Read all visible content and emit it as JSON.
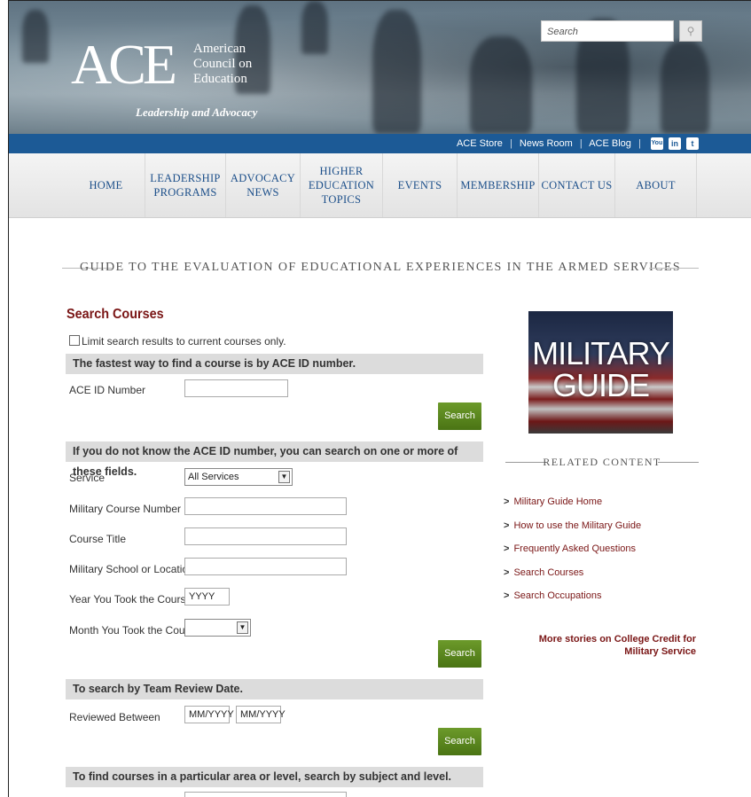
{
  "header": {
    "logo_letters": "ACE",
    "logo_line1": "American",
    "logo_line2": "Council on",
    "logo_line3": "Education",
    "tagline": "Leadership and Advocacy",
    "search_placeholder": "Search",
    "search_icon": "magnifier-icon"
  },
  "utility": {
    "store": "ACE Store",
    "newsroom": "News Room",
    "blog": "ACE Blog",
    "sep": "|",
    "youtube": "You",
    "linkedin": "in",
    "twitter": "t"
  },
  "nav": [
    "HOME",
    "LEADERSHIP PROGRAMS",
    "ADVOCACY NEWS",
    "HIGHER EDUCATION TOPICS",
    "EVENTS",
    "MEMBERSHIP",
    "CONTACT US",
    "ABOUT"
  ],
  "page_title": "GUIDE TO THE EVALUATION OF EDUCATIONAL EXPERIENCES IN THE ARMED SERVICES",
  "search": {
    "heading": "Search Courses",
    "limit_label": "Limit search results to current courses only.",
    "sec1": "The fastest way to find a course is by ACE ID number.",
    "ace_id_label": "ACE ID Number",
    "search_btn": "Search",
    "sec2": "If you do not know the ACE ID number, you can search on one or more of these fields.",
    "service_label": "Service",
    "service_value": "All Services",
    "mcn_label": "Military Course Number",
    "title_label": "Course Title",
    "school_label": "Military School or Location",
    "year_label": "Year You Took the Course",
    "year_value": "YYYY",
    "month_label": "Month You Took the Course",
    "sec3": "To search by Team Review Date.",
    "reviewed_label": "Reviewed Between",
    "date1": "MM/YYYY",
    "date2": "MM/YYYY",
    "sec4": "To find courses in a particular area or level, search by subject and level."
  },
  "sidebar": {
    "image_line1": "MILITARY",
    "image_line2": "GUIDE",
    "related_title": "RELATED CONTENT",
    "links": [
      "Military Guide Home",
      "How to use the Military Guide",
      "Frequently Asked Questions",
      "Search Courses",
      "Search Occupations"
    ],
    "bullet": ">",
    "more": "More stories on College Credit for Military Service"
  },
  "colors": {
    "brand_blue": "#1c5a96",
    "accent_red": "#7a1616",
    "button_green": "#5a8a1e"
  }
}
